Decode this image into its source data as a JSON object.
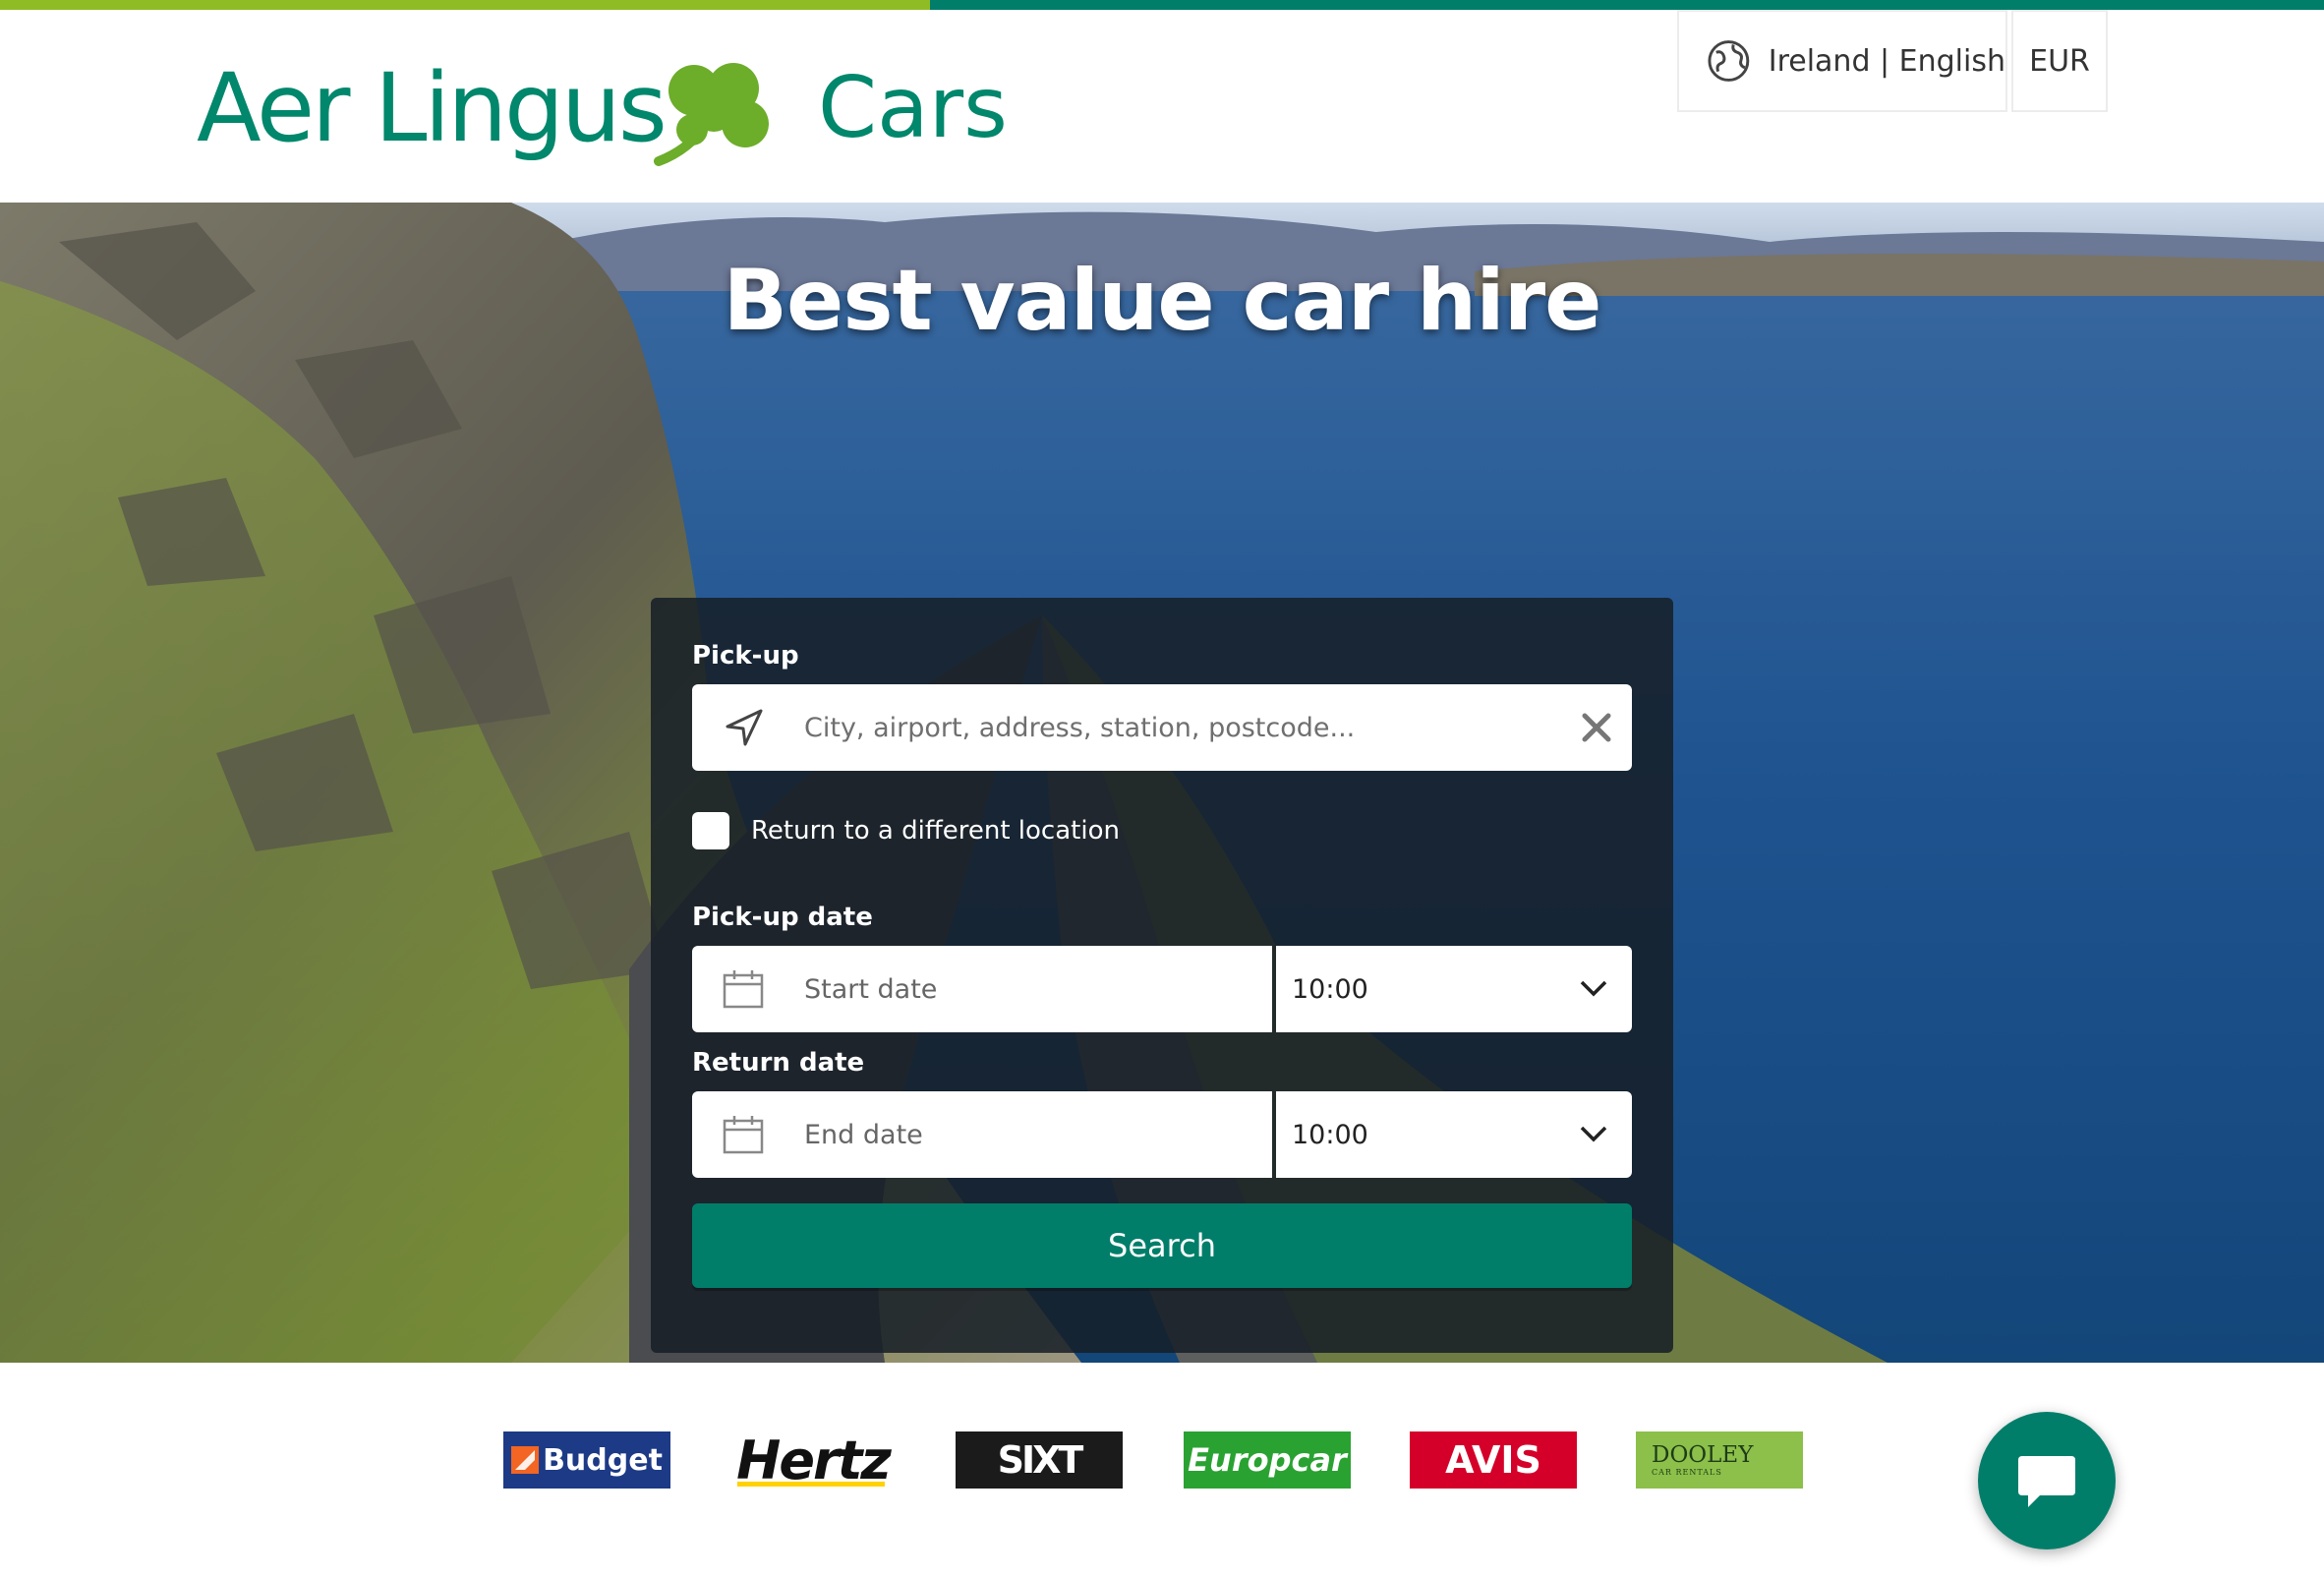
{
  "colors": {
    "lime": "#8fbb25",
    "teal": "#007e6a",
    "brand_green": "#00876c",
    "shamrock": "#6cad2a",
    "budget_bg": "#1d3a86",
    "budget_accent": "#f26522",
    "hertz_yellow": "#ffd200",
    "sixt_bg": "#1b1b1b",
    "europcar_bg": "#2aa232",
    "avis_bg": "#d4002a",
    "dooley_bg": "#8cc04a"
  },
  "header": {
    "logo_text": "Aer Lingus",
    "logo_icon": "shamrock-icon",
    "product": "Cars",
    "locale_icon": "globe-icon",
    "locale": "Ireland | English",
    "currency": "EUR"
  },
  "hero": {
    "title": "Best value car hire"
  },
  "search": {
    "pickup_label": "Pick-up",
    "pickup_icon": "location-arrow-icon",
    "pickup_placeholder": "City, airport, address, station, postcode...",
    "clear_icon": "close-icon",
    "return_different_label": "Return to a different location",
    "pickup_date_label": "Pick-up date",
    "pickup_date_placeholder": "Start date",
    "pickup_time": "10:00",
    "return_date_label": "Return date",
    "return_date_placeholder": "End date",
    "return_time": "10:00",
    "calendar_icon": "calendar-icon",
    "dropdown_icon": "chevron-down-icon",
    "search_label": "Search"
  },
  "brands": {
    "budget": "Budget",
    "hertz": "Hertz",
    "sixt": "SIXT",
    "europcar": "Europcar",
    "avis": "AVIS",
    "dooley": "DOOLEY",
    "dooley_sub": "CAR RENTALS"
  },
  "chat": {
    "icon": "chat-bubble-icon"
  }
}
